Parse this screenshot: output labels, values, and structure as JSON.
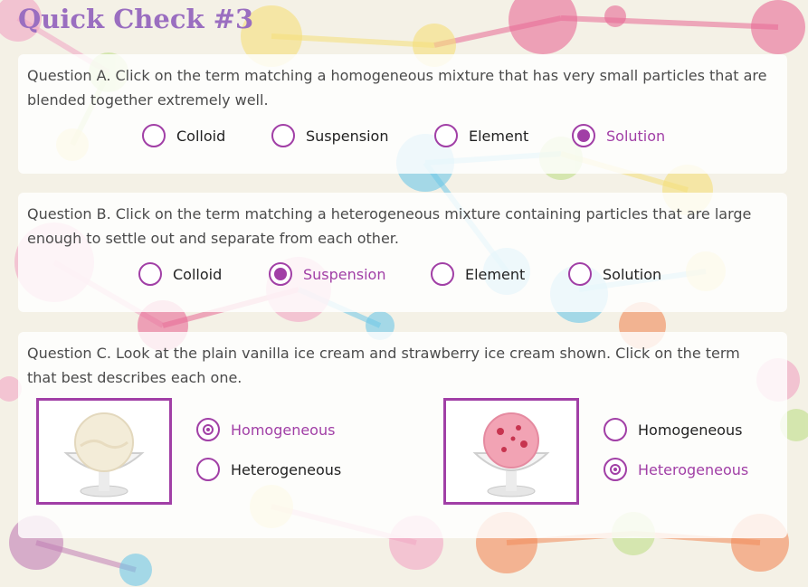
{
  "title": "Quick Check #3",
  "colors": {
    "accent": "#a13fa6",
    "title": "#9a6ec0"
  },
  "questionA": {
    "text": "Question A. Click on the term matching a homogeneous mixture that has very small particles that are blended together extremely well.",
    "options": [
      "Colloid",
      "Suspension",
      "Element",
      "Solution"
    ],
    "selected": "Solution"
  },
  "questionB": {
    "text": "Question B. Click on the term matching a heterogeneous mixture containing particles that are large enough to settle out and separate from each other.",
    "options": [
      "Colloid",
      "Suspension",
      "Element",
      "Solution"
    ],
    "selected": "Suspension"
  },
  "questionC": {
    "text": "Question C. Look at the plain vanilla ice cream and strawberry ice cream shown. Click on the term that best describes each one.",
    "vanilla": {
      "options": [
        "Homogeneous",
        "Heterogeneous"
      ],
      "selected": "Homogeneous"
    },
    "strawberry": {
      "options": [
        "Homogeneous",
        "Heterogeneous"
      ],
      "selected": "Heterogeneous"
    }
  }
}
